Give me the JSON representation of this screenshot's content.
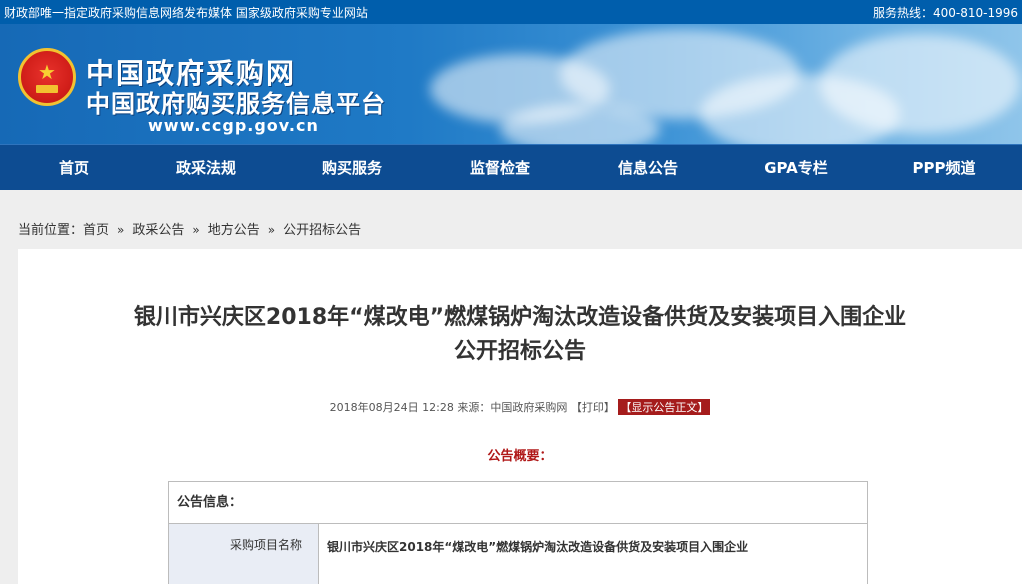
{
  "topbar": {
    "tagline": "财政部唯一指定政府采购信息网络发布媒体  国家级政府采购专业网站",
    "hotline": "服务热线：400-810-1996"
  },
  "header": {
    "site_name": "中国政府采购网",
    "site_subtitle": "中国政府购买服务信息平台",
    "url": "www.ccgp.gov.cn",
    "emblem": "national-emblem-icon"
  },
  "nav": {
    "items": [
      {
        "label": "首页"
      },
      {
        "label": "政采法规"
      },
      {
        "label": "购买服务"
      },
      {
        "label": "监督检查"
      },
      {
        "label": "信息公告"
      },
      {
        "label": "GPA专栏"
      },
      {
        "label": "PPP频道"
      }
    ]
  },
  "breadcrumb": {
    "prefix": "当前位置：",
    "items": [
      "首页",
      "政采公告",
      "地方公告",
      "公开招标公告"
    ],
    "separator": "»"
  },
  "article": {
    "title_line1": "银川市兴庆区2018年“煤改电”燃煤锅炉淘汰改造设备供货及安装项目入围企业",
    "title_line2": "公开招标公告",
    "date": "2018年08月24日 12:28",
    "source_label": "来源：",
    "source": "中国政府采购网",
    "print": "【打印】",
    "show_body": "【显示公告正文】",
    "summary_heading": "公告概要："
  },
  "info_table": {
    "header": "公告信息：",
    "rows": [
      {
        "label": "采购项目名称",
        "value": "银川市兴庆区2018年“煤改电”燃煤锅炉淘汰改造设备供货及安装项目入围企业"
      }
    ]
  },
  "colors": {
    "topbar": "#005eac",
    "nav": "#0d4c92",
    "accent_red": "#b01818"
  }
}
